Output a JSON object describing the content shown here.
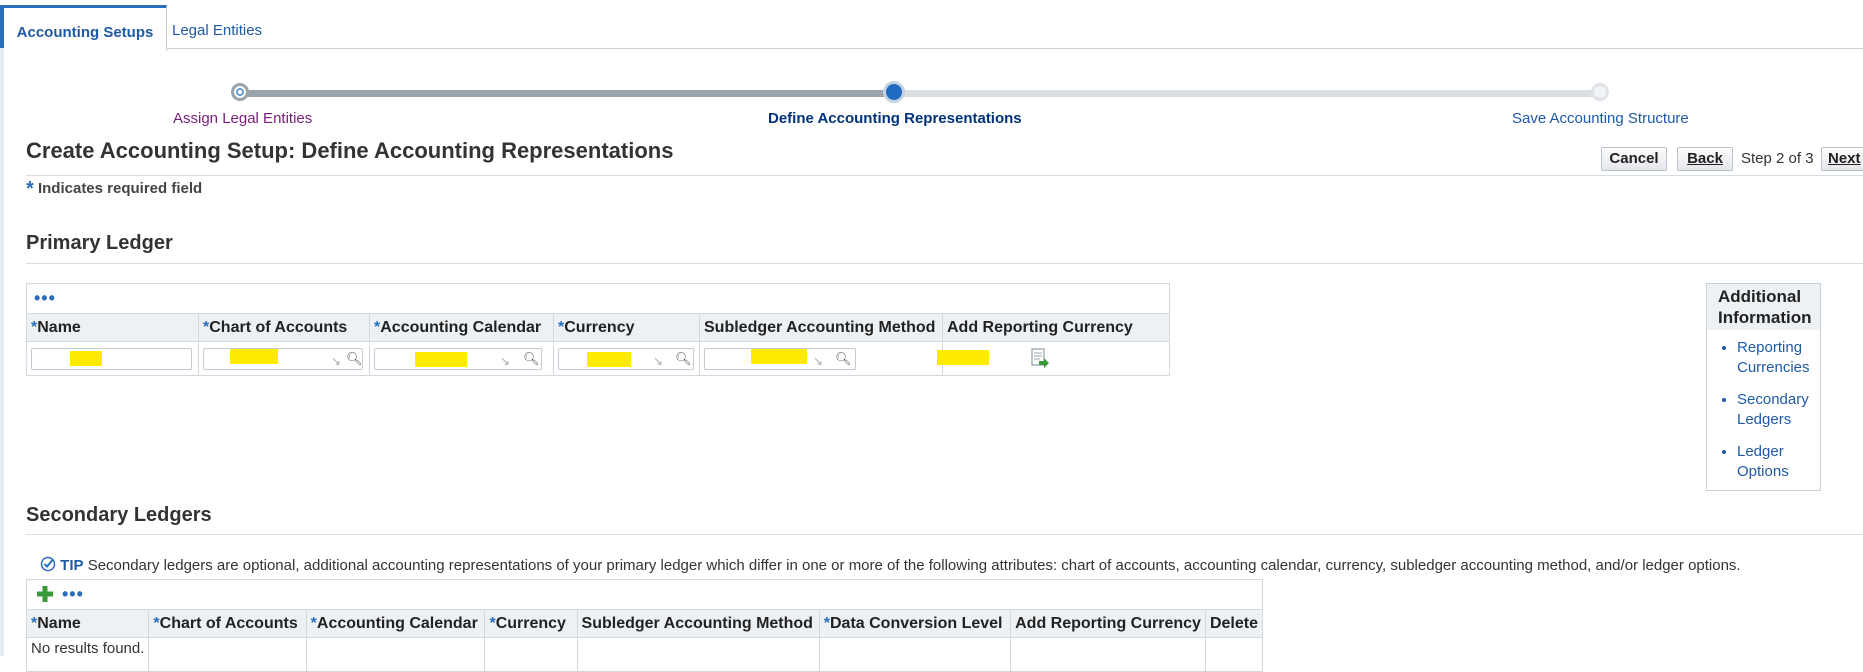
{
  "tabs": [
    {
      "label": "Accounting Setups",
      "active": true
    },
    {
      "label": "Legal Entities",
      "active": false
    }
  ],
  "train": {
    "steps": [
      {
        "label": "Assign Legal Entities",
        "state": "visited"
      },
      {
        "label": "Define Accounting Representations",
        "state": "current"
      },
      {
        "label": "Save Accounting Structure",
        "state": "unvisited"
      }
    ]
  },
  "page": {
    "title": "Create Accounting Setup: Define Accounting Representations",
    "required_star": "*",
    "required_note": "Indicates required field"
  },
  "actions": {
    "cancel": "Cancel",
    "back": "Back",
    "step_indicator": "Step 2 of 3",
    "next": "Next"
  },
  "primary_ledger": {
    "heading": "Primary Ledger",
    "toolbar_more": "•••",
    "columns": [
      {
        "label": "Name",
        "required": true
      },
      {
        "label": "Chart of Accounts",
        "required": true
      },
      {
        "label": "Accounting Calendar",
        "required": true
      },
      {
        "label": "Currency",
        "required": true
      },
      {
        "label": "Subledger Accounting Method",
        "required": false
      },
      {
        "label": "Add Reporting Currency",
        "required": false
      }
    ]
  },
  "additional_info": {
    "title": "Additional Information",
    "links": [
      "Reporting Currencies",
      "Secondary Ledgers",
      "Ledger Options"
    ]
  },
  "secondary_ledgers": {
    "heading": "Secondary Ledgers",
    "tip_label": "TIP",
    "tip_text": "Secondary ledgers are optional, additional accounting representations of your primary ledger which differ in one or more of the following attributes: chart of accounts, accounting calendar, currency, subledger accounting method, and/or ledger options.",
    "toolbar_more": "•••",
    "columns": [
      {
        "label": "Name",
        "required": true
      },
      {
        "label": "Chart of Accounts",
        "required": true
      },
      {
        "label": "Accounting Calendar",
        "required": true
      },
      {
        "label": "Currency",
        "required": true
      },
      {
        "label": "Subledger Accounting Method",
        "required": false
      },
      {
        "label": "Data Conversion Level",
        "required": true
      },
      {
        "label": "Add Reporting Currency",
        "required": false
      },
      {
        "label": "Delete",
        "required": false
      }
    ],
    "empty_text": "No results found."
  },
  "colors": {
    "link": "#1f5aa5",
    "accent": "#2a6ebb",
    "visited": "#7b1e7b",
    "current_step": "#00337a",
    "redaction": "#ffeb00"
  },
  "icons": [
    "magnifier-icon",
    "add-icon",
    "tip-check-icon",
    "add-reporting-currency-icon"
  ]
}
